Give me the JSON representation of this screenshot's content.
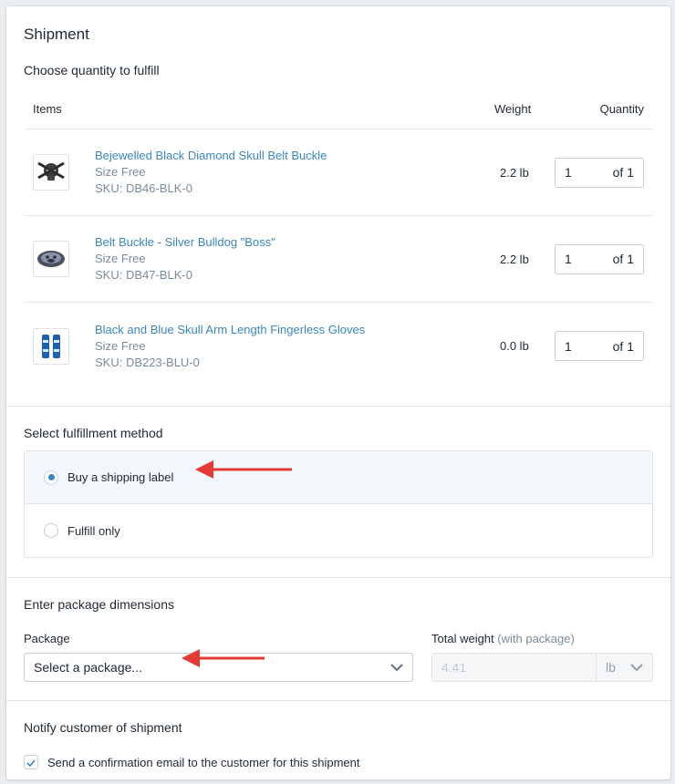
{
  "page": {
    "title": "Shipment"
  },
  "quantity": {
    "heading": "Choose quantity to fulfill",
    "columns": {
      "items": "Items",
      "weight": "Weight",
      "quantity": "Quantity"
    },
    "items": [
      {
        "title": "Bejewelled Black Diamond Skull Belt Buckle",
        "size": "Size Free",
        "sku": "SKU: DB46-BLK-0",
        "weight": "2.2 lb",
        "qty": "1",
        "of": "of 1",
        "thumb": "skull-buckle-image"
      },
      {
        "title": "Belt Buckle - Silver Bulldog \"Boss\"",
        "size": "Size Free",
        "sku": "SKU: DB47-BLK-0",
        "weight": "2.2 lb",
        "qty": "1",
        "of": "of 1",
        "thumb": "bulldog-buckle-image"
      },
      {
        "title": "Black and Blue Skull Arm Length Fingerless Gloves",
        "size": "Size Free",
        "sku": "SKU: DB223-BLU-0",
        "weight": "0.0 lb",
        "qty": "1",
        "of": "of 1",
        "thumb": "gloves-image"
      }
    ]
  },
  "fulfillment": {
    "heading": "Select fulfillment method",
    "options": [
      {
        "label": "Buy a shipping label",
        "selected": true
      },
      {
        "label": "Fulfill only",
        "selected": false
      }
    ]
  },
  "package": {
    "heading": "Enter package dimensions",
    "package_label": "Package",
    "package_select": "Select a package...",
    "weight_label": "Total weight",
    "weight_hint": "(with package)",
    "weight_value": "4.41",
    "weight_unit": "lb"
  },
  "notify": {
    "heading": "Notify customer of shipment",
    "checkbox_label": "Send a confirmation email to the customer for this shipment",
    "checked": true
  },
  "colors": {
    "accent": "#3a86c4",
    "annotation_arrow": "#e53935"
  }
}
